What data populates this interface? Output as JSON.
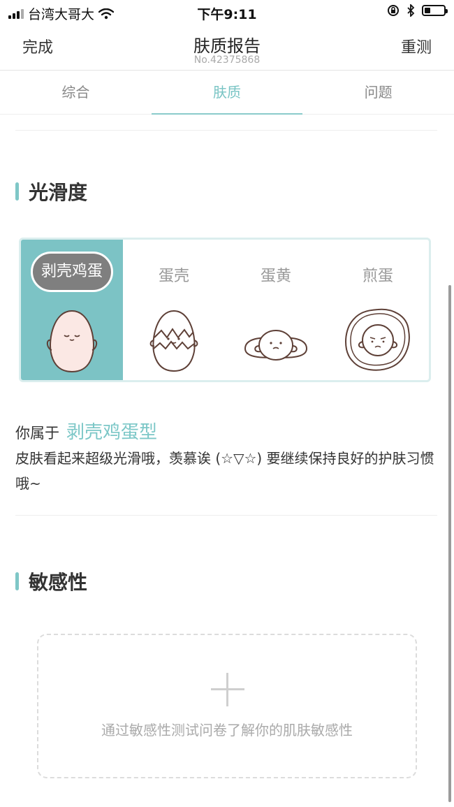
{
  "status_bar": {
    "carrier": "台湾大哥大",
    "time": "下午9:11",
    "battery_level": 0.3
  },
  "nav": {
    "left_label": "完成",
    "title": "肤质报告",
    "subtitle": "No.42375868",
    "right_label": "重测"
  },
  "tabs": [
    {
      "label": "综合",
      "active": false
    },
    {
      "label": "肤质",
      "active": true
    },
    {
      "label": "问题",
      "active": false
    }
  ],
  "smoothness": {
    "title": "光滑度",
    "options": [
      {
        "label": "剥壳鸡蛋",
        "selected": true,
        "icon": "peeled-egg-icon"
      },
      {
        "label": "蛋壳",
        "selected": false,
        "icon": "cracked-eggshell-icon"
      },
      {
        "label": "蛋黄",
        "selected": false,
        "icon": "egg-yolk-icon"
      },
      {
        "label": "煎蛋",
        "selected": false,
        "icon": "fried-egg-icon"
      }
    ],
    "result_prefix": "你属于",
    "result_type": "剥壳鸡蛋型",
    "result_desc": "皮肤看起来超级光滑哦，羡慕诶 (☆▽☆) 要继续保持良好的护肤习惯哦~"
  },
  "sensitivity": {
    "title": "敏感性",
    "add_text": "通过敏感性测试问卷了解你的肌肤敏感性"
  },
  "colors": {
    "accent": "#7cc3c5",
    "selected_pill": "#7f7f7f",
    "egg_outline": "#6b4a40",
    "egg_fill": "#fbe8e4"
  }
}
